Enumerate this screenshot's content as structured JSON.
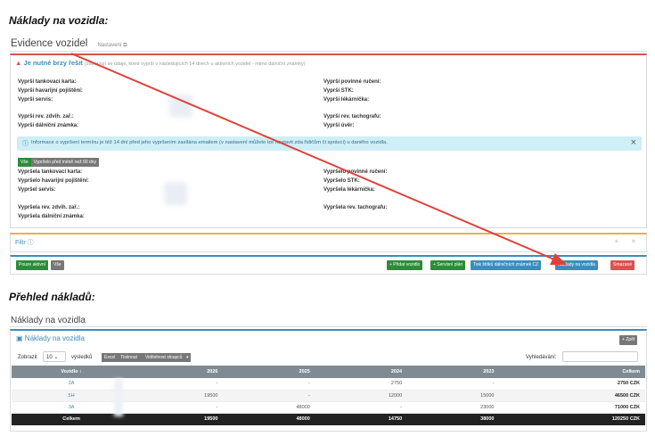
{
  "headings": {
    "h1": "Náklady na vozidla:",
    "h2": "Přehled nákladů:"
  },
  "evidence": {
    "title": "Evidence vozidel",
    "settings": "Nastavení"
  },
  "alert": {
    "title": "Je nutné brzy řešit",
    "subtitle": "(zobrazují se údaje, které vyprší v následujících 14 dnech u aktivních vozidel - mimo dálniční známky)",
    "left_items": [
      "Vyprší tankovací karta:",
      "Vyprší havarijní pojištění:",
      "Vyprší servis:",
      "Vyprší rev. zdvih. zař.:",
      "Vyprší dálniční známka:"
    ],
    "right_items": [
      "Vyprší povinné ručení:",
      "Vyprší STK:",
      "Vyprší lékárnička:",
      "Vyprší rev. tachografu:",
      "Vyprší úvěr:"
    ],
    "info": "Informace o vypršení termínu je též 14 dní před jeho vypršením zasílána emailem (v nastavení můžete lze nastavit zda řidičům či správci) u daného vozidla.",
    "seg_all": "Vše",
    "seg_expired": "Vypršelo před méně než 90 dny",
    "expired_left": [
      "Vypršela tankovací karta:",
      "Vypršelo havarijní pojištění:",
      "Vypršel servis:",
      "Vypršela rev. zdvih. zař.:",
      "Vypršela dálniční známka:"
    ],
    "expired_right": [
      "Vypršelo povinné ručení:",
      "Vypršelo STK:",
      "Vypršela lékárnička:",
      "Vypršela rev. tachografu:"
    ]
  },
  "filter": {
    "title": "Filtr",
    "ctrl": "+ ×"
  },
  "toolbar": {
    "only_active": "Pouze aktivní",
    "all": "Vše",
    "add_vehicle": "+ Přidat vozidlo",
    "service_plan": "+ Servisní plán",
    "print_stickers": "Tisk štítků dálničních známek CZ",
    "costs": "Náklady na vozidla",
    "deleted": "Smazané"
  },
  "costs": {
    "section_title": "Náklady na vozidla",
    "box_title": "Náklady na vozidla",
    "back": "Zpět",
    "show": "Zobrazit",
    "page_size": "10",
    "results": "výsledků",
    "export": [
      "Excel",
      "Tisknout",
      "Viditelnost sloupců"
    ],
    "search_label": "Vyhledávání:",
    "columns": [
      "Vozidlo",
      "2026",
      "2025",
      "2024",
      "2023",
      "Celkem"
    ],
    "rows": [
      [
        "2A",
        "-",
        "-",
        "2750",
        "-",
        "2750 CZK"
      ],
      [
        "5H",
        "19500",
        "-",
        "12000",
        "15000",
        "46500 CZK"
      ],
      [
        "3A",
        "-",
        "48000",
        "-",
        "23000",
        "71000 CZK"
      ]
    ],
    "footer": [
      "Celkem",
      "19500",
      "48000",
      "14750",
      "38000",
      "120250 CZK"
    ]
  },
  "colors": {
    "primary": "#3c8dbc",
    "danger": "#d9534f",
    "success": "#2e8b3a",
    "annotation_arrow": "#e0403a"
  }
}
